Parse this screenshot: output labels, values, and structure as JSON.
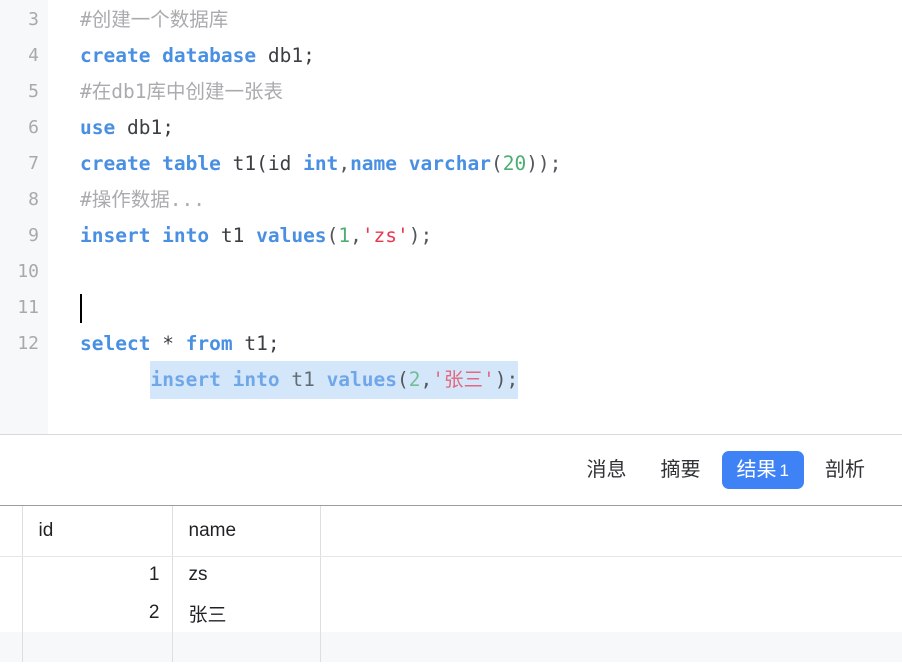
{
  "editor": {
    "first_line_number": 3,
    "lines": [
      {
        "number": "3",
        "text": "#创建一个数据库"
      },
      {
        "number": "4",
        "text": "create database db1;"
      },
      {
        "number": "5",
        "text": "#在db1库中创建一张表"
      },
      {
        "number": "6",
        "text": "use db1;"
      },
      {
        "number": "7",
        "text": "create table t1(id int,name varchar(20));"
      },
      {
        "number": "8",
        "text": "#操作数据..."
      },
      {
        "number": "9",
        "text": "insert into t1 values(1,'zs');"
      },
      {
        "number": "10",
        "text": ""
      },
      {
        "number": "11",
        "text": "insert into t1 values(2,'张三');"
      },
      {
        "number": "12",
        "text": "select * from t1;"
      }
    ],
    "selected_line_number": "11",
    "selected_line_text": "insert into t1 values(2,'张三');",
    "tokens": {
      "line3": [
        {
          "t": "#创建一个数据库",
          "c": "cmt"
        }
      ],
      "line4": [
        {
          "t": "create database",
          "c": "kw"
        },
        {
          "t": " db1;",
          "c": "plain"
        }
      ],
      "line5": [
        {
          "t": "#在db1库中创建一张表",
          "c": "cmt"
        }
      ],
      "line6": [
        {
          "t": "use",
          "c": "kw"
        },
        {
          "t": " db1;",
          "c": "plain"
        }
      ],
      "line7": [
        {
          "t": "create table",
          "c": "kw"
        },
        {
          "t": " t1(id ",
          "c": "plain"
        },
        {
          "t": "int",
          "c": "kw"
        },
        {
          "t": ",",
          "c": "punc"
        },
        {
          "t": "name varchar",
          "c": "kw"
        },
        {
          "t": "(",
          "c": "punc"
        },
        {
          "t": "20",
          "c": "num"
        },
        {
          "t": "));",
          "c": "punc"
        }
      ],
      "line8": [
        {
          "t": "#操作数据...",
          "c": "cmt"
        }
      ],
      "line9": [
        {
          "t": "insert into",
          "c": "kw"
        },
        {
          "t": " t1 ",
          "c": "plain"
        },
        {
          "t": "values",
          "c": "kw"
        },
        {
          "t": "(",
          "c": "punc"
        },
        {
          "t": "1",
          "c": "num"
        },
        {
          "t": ",",
          "c": "punc"
        },
        {
          "t": "'zs'",
          "c": "str"
        },
        {
          "t": ");",
          "c": "punc"
        }
      ],
      "line10": [],
      "line11": [
        {
          "t": "insert into",
          "c": "kw"
        },
        {
          "t": " t1 ",
          "c": "plain"
        },
        {
          "t": "values",
          "c": "kw"
        },
        {
          "t": "(",
          "c": "punc"
        },
        {
          "t": "2",
          "c": "num"
        },
        {
          "t": ",",
          "c": "punc"
        },
        {
          "t": "'张三'",
          "c": "str"
        },
        {
          "t": ");",
          "c": "punc"
        }
      ],
      "line12": [
        {
          "t": "select",
          "c": "kw"
        },
        {
          "t": " * ",
          "c": "plain"
        },
        {
          "t": "from",
          "c": "kw"
        },
        {
          "t": " t1;",
          "c": "plain"
        }
      ]
    },
    "colors": {
      "keyword": "#4a90e2",
      "number": "#4caf71",
      "string": "#e8384f",
      "comment": "#a9abae",
      "plain": "#3a3f44",
      "selection_bg": "#d4e6fa",
      "gutter_bg": "#f7f8f9",
      "gutter_text": "#a8a9ad",
      "caret": "#000000"
    }
  },
  "tabs": {
    "items": [
      {
        "label": "消息",
        "count": "",
        "active": false
      },
      {
        "label": "摘要",
        "count": "",
        "active": false
      },
      {
        "label": "结果",
        "count": "1",
        "active": true
      },
      {
        "label": "剖析",
        "count": "",
        "active": false
      }
    ],
    "active_label": "结果 1",
    "active_color": "#3f82f6"
  },
  "result_grid": {
    "columns": [
      "",
      "id",
      "name",
      ""
    ],
    "column_headers": {
      "gutter": "",
      "id": "id",
      "name": "name",
      "rest": ""
    },
    "rows": [
      {
        "gutter": "",
        "id": "1",
        "name": "zs",
        "rest": ""
      },
      {
        "gutter": "",
        "id": "2",
        "name": "张三",
        "rest": ""
      }
    ],
    "row_count": 2,
    "colors": {
      "header_border": "#9b9da0",
      "cell_border": "#dcdee0",
      "filler_bg": "#f7f8f9"
    }
  }
}
